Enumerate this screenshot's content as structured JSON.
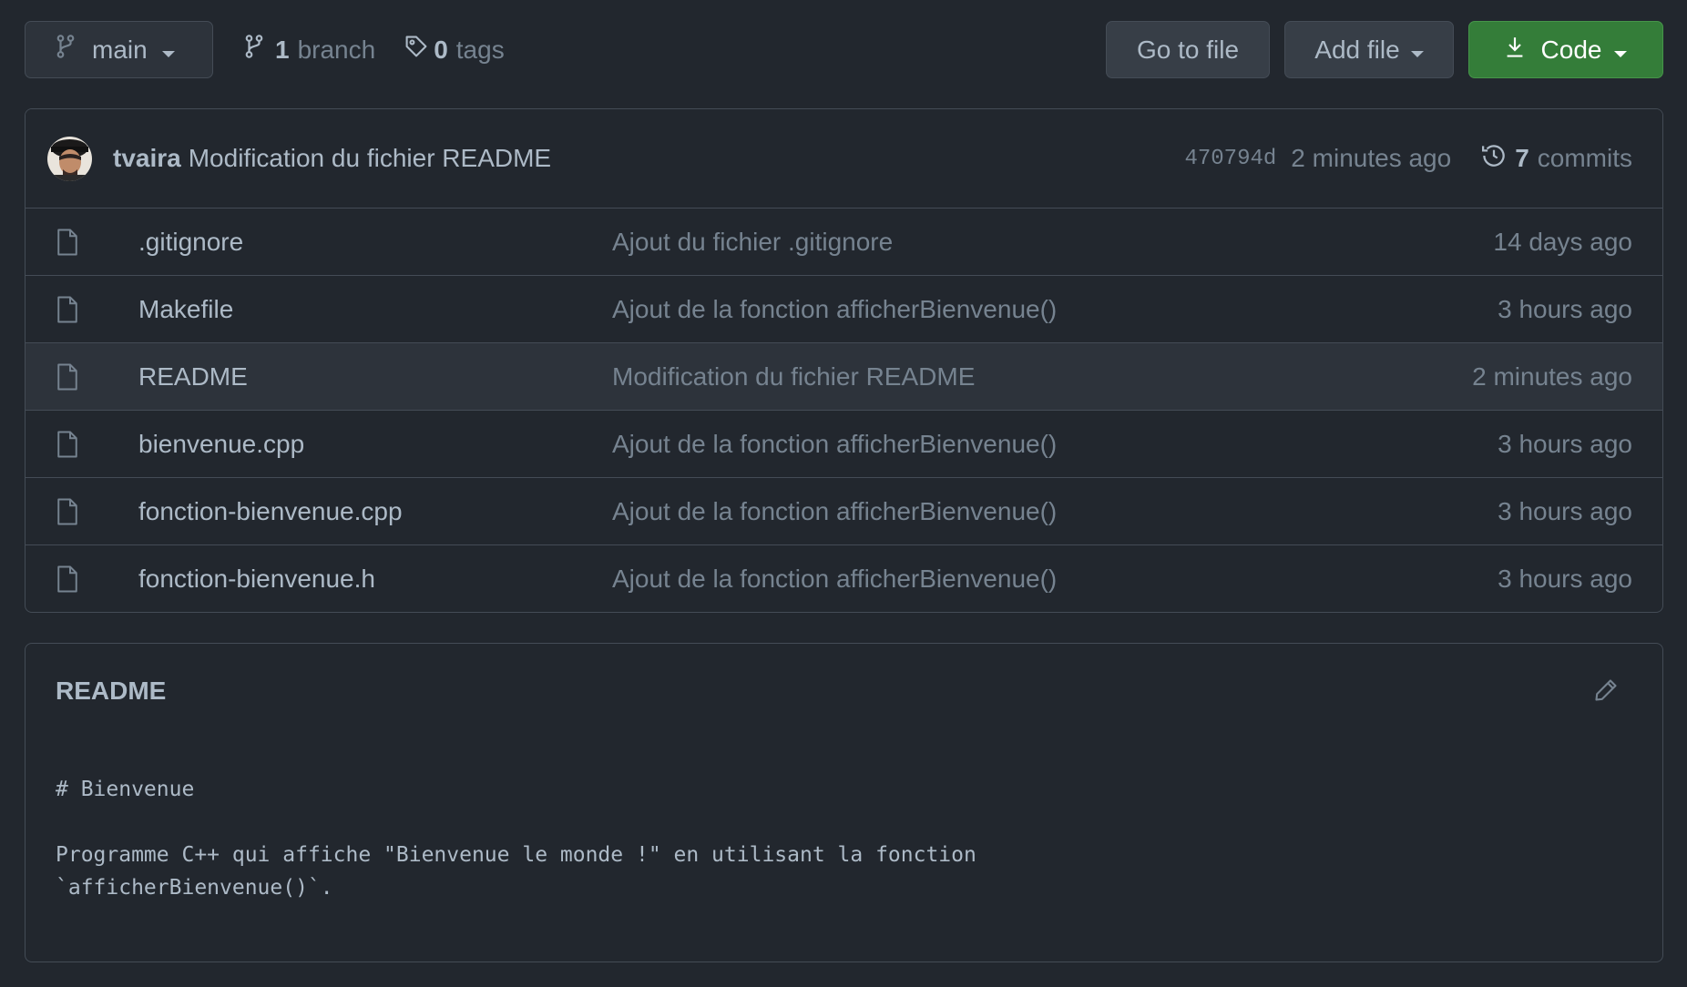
{
  "toolbar": {
    "branch_selector": {
      "label": "main"
    },
    "branches": {
      "count": "1",
      "label": "branch"
    },
    "tags": {
      "count": "0",
      "label": "tags"
    },
    "go_to_file": "Go to file",
    "add_file": "Add file",
    "code": "Code"
  },
  "latest_commit": {
    "author": "tvaira",
    "message": "Modification du fichier README",
    "sha": "470794d",
    "time": "2 minutes ago",
    "commits_count": "7",
    "commits_label": "commits"
  },
  "files": [
    {
      "name": ".gitignore",
      "commit": "Ajout du fichier .gitignore",
      "age": "14 days ago"
    },
    {
      "name": "Makefile",
      "commit": "Ajout de la fonction afficherBienvenue()",
      "age": "3 hours ago"
    },
    {
      "name": "README",
      "commit": "Modification du fichier README",
      "age": "2 minutes ago"
    },
    {
      "name": "bienvenue.cpp",
      "commit": "Ajout de la fonction afficherBienvenue()",
      "age": "3 hours ago"
    },
    {
      "name": "fonction-bienvenue.cpp",
      "commit": "Ajout de la fonction afficherBienvenue()",
      "age": "3 hours ago"
    },
    {
      "name": "fonction-bienvenue.h",
      "commit": "Ajout de la fonction afficherBienvenue()",
      "age": "3 hours ago"
    }
  ],
  "readme": {
    "title": "README",
    "content": "# Bienvenue\n\nProgramme C++ qui affiche \"Bienvenue le monde !\" en utilisant la fonction\n`afficherBienvenue()`."
  },
  "colors": {
    "background": "#22272e",
    "border": "#444c56",
    "text": "#adbac7",
    "muted": "#768390",
    "code_button": "#347d39"
  },
  "icons": {
    "branch": "git-branch-icon",
    "tag": "tag-icon",
    "download": "download-icon",
    "history": "history-icon",
    "file": "file-icon",
    "edit": "pencil-icon"
  }
}
